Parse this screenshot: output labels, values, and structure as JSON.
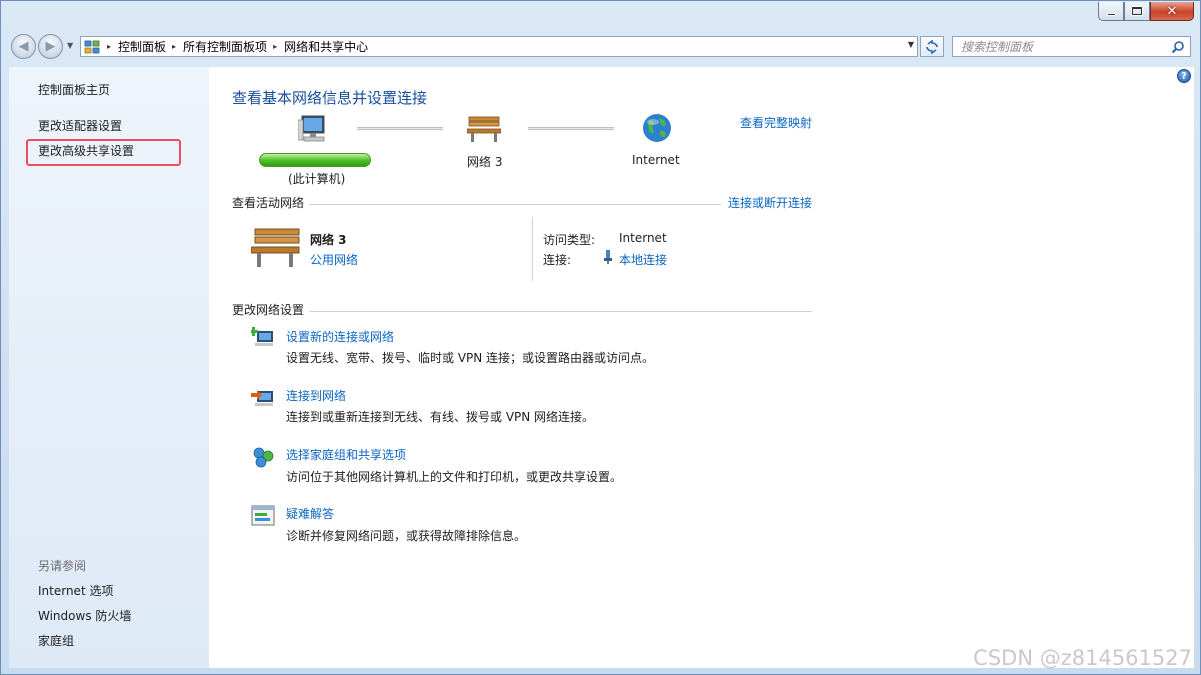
{
  "window": {
    "close_glyph": "✕"
  },
  "address_bar": {
    "crumbs": [
      "控制面板",
      "所有控制面板项",
      "网络和共享中心"
    ],
    "separator": "▸"
  },
  "search": {
    "placeholder": "搜索控制面板"
  },
  "sidebar": {
    "home": "控制面板主页",
    "items": [
      {
        "label": "更改适配器设置"
      },
      {
        "label": "更改高级共享设置"
      }
    ],
    "see_also_header": "另请参阅",
    "see_also": [
      {
        "label": "Internet 选项"
      },
      {
        "label": "Windows 防火墙"
      },
      {
        "label": "家庭组"
      }
    ]
  },
  "main": {
    "title": "查看基本网络信息并设置连接",
    "view_full_map": "查看完整映射",
    "map": {
      "computer_label": "(此计算机)",
      "network_label": "网络  3",
      "internet_label": "Internet"
    },
    "active_networks": {
      "header": "查看活动网络",
      "action": "连接或断开连接",
      "network_name": "网络  3",
      "network_type": "公用网络",
      "access_type_label": "访问类型:",
      "access_type_value": "Internet",
      "connections_label": "连接:",
      "connections_value": "本地连接"
    },
    "change_settings": {
      "header": "更改网络设置",
      "tasks": [
        {
          "title": "设置新的连接或网络",
          "desc": "设置无线、宽带、拨号、临时或 VPN 连接；或设置路由器或访问点。",
          "icon": "new-connection-icon"
        },
        {
          "title": "连接到网络",
          "desc": "连接到或重新连接到无线、有线、拨号或 VPN 网络连接。",
          "icon": "connect-network-icon"
        },
        {
          "title": "选择家庭组和共享选项",
          "desc": "访问位于其他网络计算机上的文件和打印机，或更改共享设置。",
          "icon": "homegroup-icon"
        },
        {
          "title": "疑难解答",
          "desc": "诊断并修复网络问题，或获得故障排除信息。",
          "icon": "troubleshoot-icon"
        }
      ]
    }
  },
  "watermark": "CSDN @z814561527",
  "colors": {
    "link": "#0b66c3",
    "highlight_border": "#ef4c5e",
    "progress_green": "#52c32a"
  }
}
